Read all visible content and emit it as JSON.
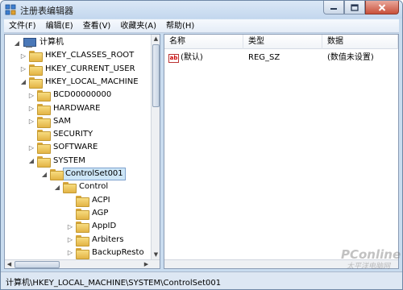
{
  "window": {
    "title": "注册表编辑器"
  },
  "colors": {
    "selection": "#cde6f7",
    "selection_border": "#7da2ce",
    "folder": "#e3b445",
    "titlebar": "#c3d7ee"
  },
  "menu": [
    "文件(F)",
    "编辑(E)",
    "查看(V)",
    "收藏夹(A)",
    "帮助(H)"
  ],
  "tree": {
    "items": [
      {
        "label": "计算机",
        "icon": "computer-icon",
        "toggle": "expanded",
        "level": 0
      },
      {
        "label": "HKEY_CLASSES_ROOT",
        "icon": "folder-icon",
        "toggle": "collapsed",
        "level": 1
      },
      {
        "label": "HKEY_CURRENT_USER",
        "icon": "folder-icon",
        "toggle": "collapsed",
        "level": 1
      },
      {
        "label": "HKEY_LOCAL_MACHINE",
        "icon": "folder-icon",
        "toggle": "expanded",
        "level": 1
      },
      {
        "label": "BCD00000000",
        "icon": "folder-icon",
        "toggle": "collapsed",
        "level": 2
      },
      {
        "label": "HARDWARE",
        "icon": "folder-icon",
        "toggle": "collapsed",
        "level": 2
      },
      {
        "label": "SAM",
        "icon": "folder-icon",
        "toggle": "collapsed",
        "level": 2
      },
      {
        "label": "SECURITY",
        "icon": "folder-icon",
        "toggle": "none",
        "level": 2
      },
      {
        "label": "SOFTWARE",
        "icon": "folder-icon",
        "toggle": "collapsed",
        "level": 2
      },
      {
        "label": "SYSTEM",
        "icon": "folder-icon",
        "toggle": "expanded",
        "level": 2
      },
      {
        "label": "ControlSet001",
        "icon": "folder-icon",
        "toggle": "expanded",
        "level": 3,
        "selected": true
      },
      {
        "label": "Control",
        "icon": "folder-icon",
        "toggle": "expanded",
        "level": 4
      },
      {
        "label": "ACPI",
        "icon": "folder-icon",
        "toggle": "none",
        "level": 5
      },
      {
        "label": "AGP",
        "icon": "folder-icon",
        "toggle": "none",
        "level": 5
      },
      {
        "label": "AppID",
        "icon": "folder-icon",
        "toggle": "collapsed",
        "level": 5
      },
      {
        "label": "Arbiters",
        "icon": "folder-icon",
        "toggle": "collapsed",
        "level": 5
      },
      {
        "label": "BackupResto",
        "icon": "folder-icon",
        "toggle": "collapsed",
        "level": 5
      }
    ]
  },
  "list": {
    "columns": [
      "名称",
      "类型",
      "数据"
    ],
    "rows": [
      {
        "icon": "string-value-icon",
        "name": "(默认)",
        "type": "REG_SZ",
        "data": "(数值未设置)"
      }
    ]
  },
  "status": {
    "path": "计算机\\HKEY_LOCAL_MACHINE\\SYSTEM\\ControlSet001"
  },
  "watermark": {
    "line1": "PConline",
    "line2": "太平洋电脑网"
  }
}
